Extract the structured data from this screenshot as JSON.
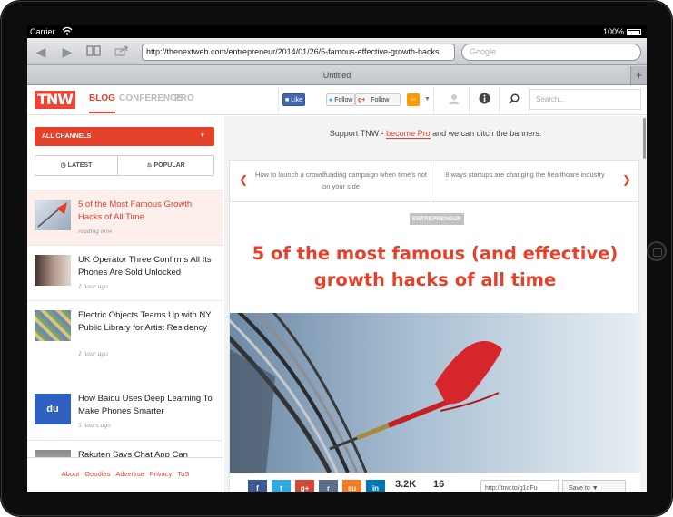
{
  "status_bar": {
    "carrier": "Carrier",
    "time": "",
    "battery": "100%"
  },
  "browser": {
    "url": "http://thenextweb.com/entrepreneur/2014/01/26/5-famous-effective-growth-hacks",
    "search_placeholder": "Google",
    "tab_title": "Untitled",
    "icons": [
      "back-icon",
      "forward-icon",
      "bookmarks-icon",
      "share-icon",
      "new-tab-icon"
    ]
  },
  "site_header": {
    "logo": "TNW",
    "nav": [
      {
        "label": "BLOG",
        "active": true
      },
      {
        "label": "CONFERENCE",
        "active": false
      },
      {
        "label": "PRO",
        "active": false
      }
    ],
    "like_label": "Like",
    "twitter_follow": "Follow",
    "gplus_follow": "Follow",
    "search_placeholder": "Search..."
  },
  "sidebar": {
    "channels_label": "ALL CHANNELS",
    "tab_latest": "LATEST",
    "tab_popular": "POPULAR",
    "items": [
      {
        "title": "5 of the Most Famous Growth Hacks of All Time",
        "time": "reading now"
      },
      {
        "title": "UK Operator Three Confirms All Its Phones Are Sold Unlocked",
        "time": "1 hour ago"
      },
      {
        "title": "Electric Objects Teams Up with NY Public Library for Artist Residency",
        "time": "1 hour ago"
      },
      {
        "title": "How Baidu Uses Deep Learning To Make Phones Smarter",
        "time": "5 hours ago"
      },
      {
        "title": "Rakuten Says Chat App Can",
        "time": ""
      }
    ],
    "footer_links": [
      "About",
      "Goodies",
      "Advertise",
      "Privacy",
      "ToS"
    ]
  },
  "main": {
    "support_prefix": "Support TNW - ",
    "support_link": "become Pro",
    "support_suffix": " and we can ditch the banners.",
    "related_prev": "How to launch a crowdfunding campaign when time's not on your side",
    "related_next": "8 ways startups are changing the healthcare industry",
    "category": "ENTREPRENEUR",
    "headline": "5 of the most famous (and effective) growth hacks of all time",
    "share_count": "3.2K",
    "comment_count": "16",
    "short_url": "http://tnw.to/g1oFu",
    "save_to": "Save to"
  },
  "colors": {
    "accent": "#e4412b",
    "facebook": "#3b5998",
    "twitter": "#2fa9e0",
    "gplus": "#d34836",
    "stumble": "#f47b20",
    "linkedin": "#0077b5"
  }
}
